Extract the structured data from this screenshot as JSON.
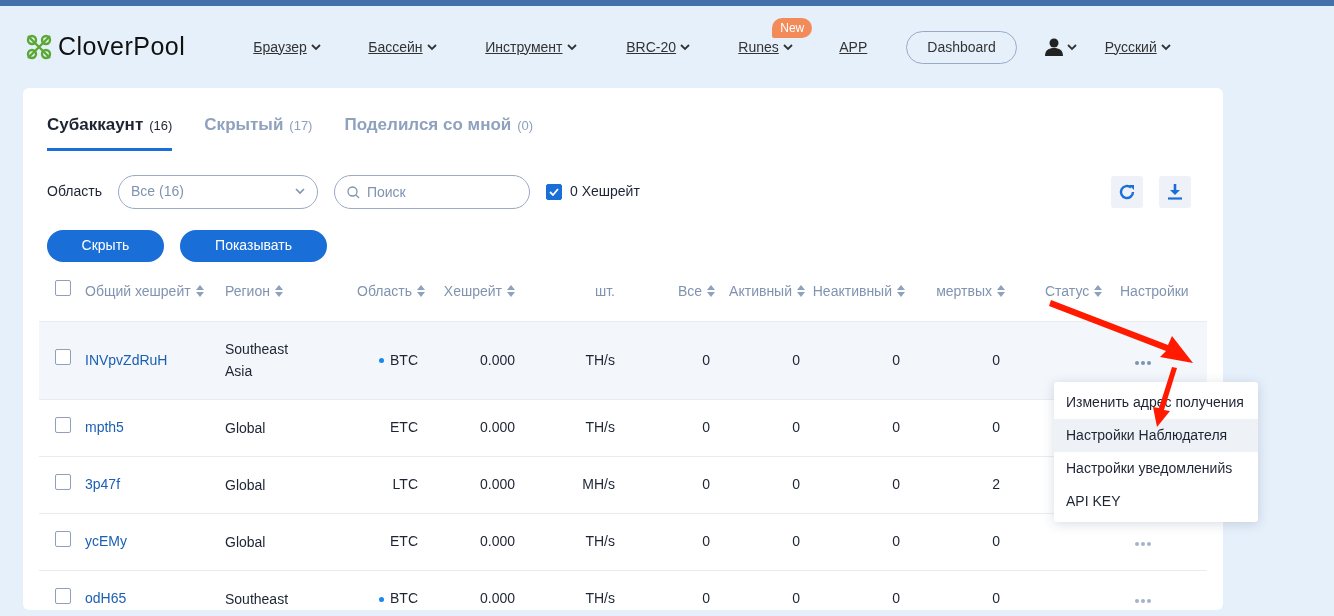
{
  "brand": {
    "name": "CloverPool"
  },
  "nav": [
    {
      "label": "Браузер",
      "dropdown": true
    },
    {
      "label": "Бассейн",
      "dropdown": true
    },
    {
      "label": "Инструмент",
      "dropdown": true
    },
    {
      "label": "BRC-20",
      "dropdown": true
    },
    {
      "label": "Runes",
      "dropdown": true,
      "badge": "New"
    },
    {
      "label": "APP",
      "dropdown": false
    }
  ],
  "dashboard_button": "Dashboard",
  "language": "Русский",
  "tabs": [
    {
      "label": "Субаккаунт",
      "count": "(16)",
      "selected": true
    },
    {
      "label": "Скрытый",
      "count": "(17)",
      "selected": false
    },
    {
      "label": "Поделился со мной",
      "count": "(0)",
      "selected": false
    }
  ],
  "filters": {
    "area_label": "Область",
    "area_value": "Все (16)",
    "search_placeholder": "Поиск",
    "zero_hashrate": {
      "label": "0 Хешрейт",
      "checked": true
    }
  },
  "actions": [
    "Скрыть",
    "Показывать"
  ],
  "table": {
    "select_all_checked": false,
    "columns": [
      {
        "label": "Общий хешрейт",
        "sortable": true
      },
      {
        "label": "Регион",
        "sortable": true
      },
      {
        "label": "Область",
        "sortable": true
      },
      {
        "label": "Хешрейт",
        "sortable": true
      },
      {
        "label": "шт.",
        "sortable": false
      },
      {
        "label": "Все",
        "sortable": true
      },
      {
        "label": "Активный",
        "sortable": true
      },
      {
        "label": "Неактивный",
        "sortable": true
      },
      {
        "label": "мертвых",
        "sortable": true
      },
      {
        "label": "Статус",
        "sortable": true
      },
      {
        "label": "Настройки",
        "sortable": false
      }
    ],
    "rows": [
      {
        "checked": false,
        "highlighted": true,
        "name": "INVpvZdRuH",
        "region": "Southeast Asia",
        "marked": true,
        "coin": "BTC",
        "hashrate": "0.000",
        "unit": "TH/s",
        "all": "0",
        "active": "0",
        "inactive": "0",
        "dead": "0",
        "menu_open": true
      },
      {
        "checked": false,
        "highlighted": false,
        "name": "mpth5",
        "region": "Global",
        "marked": false,
        "coin": "ETC",
        "hashrate": "0.000",
        "unit": "TH/s",
        "all": "0",
        "active": "0",
        "inactive": "0",
        "dead": "0"
      },
      {
        "checked": false,
        "highlighted": false,
        "name": "3p47f",
        "region": "Global",
        "marked": false,
        "coin": "LTC",
        "hashrate": "0.000",
        "unit": "MH/s",
        "all": "0",
        "active": "0",
        "inactive": "0",
        "dead": "2"
      },
      {
        "checked": false,
        "highlighted": false,
        "name": "ycEMy",
        "region": "Global",
        "marked": false,
        "coin": "ETC",
        "hashrate": "0.000",
        "unit": "TH/s",
        "all": "0",
        "active": "0",
        "inactive": "0",
        "dead": "0"
      },
      {
        "checked": false,
        "highlighted": false,
        "name": "odH65",
        "region": "Southeast",
        "marked": true,
        "coin": "BTC",
        "hashrate": "0.000",
        "unit": "TH/s",
        "all": "0",
        "active": "0",
        "inactive": "0",
        "dead": "0"
      }
    ]
  },
  "row_menu": [
    {
      "label": "Изменить адрес получения",
      "selected": false
    },
    {
      "label": "Настройки Наблюдателя",
      "selected": true
    },
    {
      "label": "Настройки уведомленийs",
      "selected": false
    },
    {
      "label": "API KEY",
      "selected": false
    }
  ]
}
